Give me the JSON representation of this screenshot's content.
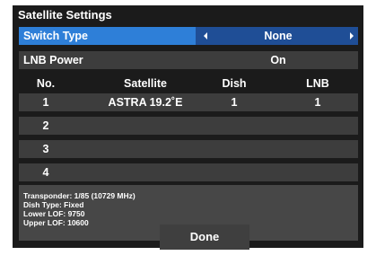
{
  "title": "Satellite Settings",
  "switch_type": {
    "label": "Switch Type",
    "value": "None"
  },
  "lnb_power": {
    "label": "LNB Power",
    "value": "On"
  },
  "table": {
    "headers": [
      "No.",
      "Satellite",
      "Dish",
      "LNB"
    ],
    "rows": [
      {
        "no": "1",
        "satellite": "ASTRA 19.2˚E",
        "dish": "1",
        "lnb": "1"
      },
      {
        "no": "2",
        "satellite": "",
        "dish": "",
        "lnb": ""
      },
      {
        "no": "3",
        "satellite": "",
        "dish": "",
        "lnb": ""
      },
      {
        "no": "4",
        "satellite": "",
        "dish": "",
        "lnb": ""
      }
    ]
  },
  "info": {
    "transponder": "Transponder: 1/85 (10729 MHz)",
    "dish_type": "Dish Type: Fixed",
    "lower_lof": "Lower LOF: 9750",
    "upper_lof": "Upper LOF: 10600"
  },
  "done_label": "Done",
  "colors": {
    "panel": "#1b1b1b",
    "row": "#3d3d3d",
    "selected_label": "#2e7fd8",
    "selected_value": "#1f4e96",
    "info_box": "#474747"
  }
}
